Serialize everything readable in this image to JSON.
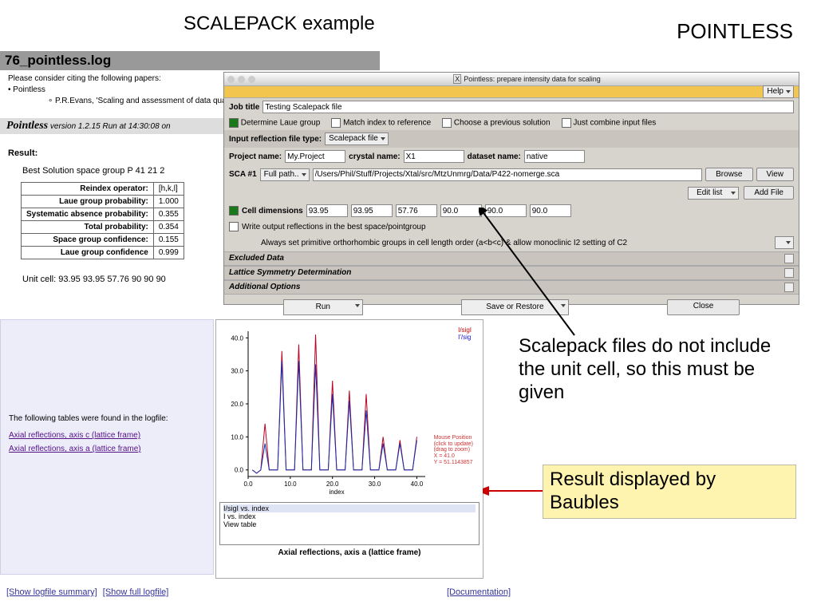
{
  "titles": {
    "left": "SCALEPACK example",
    "right": "POINTLESS"
  },
  "log": {
    "filename": "76_pointless.log",
    "intro": "Please consider citing the following papers:",
    "ref_item": "Pointless",
    "ref_detail": "P.R.Evans, 'Scaling and assessment of data quality', Acta",
    "section_hdr": "Pointless",
    "section_sub": "version 1.2.15 Run at 14:30:08 on",
    "result_label": "Result:",
    "best_solution": "Best Solution space group P 41 21 2",
    "table": {
      "rows": [
        {
          "k": "Reindex operator:",
          "v": "[h,k,l]"
        },
        {
          "k": "Laue group probability:",
          "v": "1.000"
        },
        {
          "k": "Systematic absence probability:",
          "v": "0.355"
        },
        {
          "k": "Total probability:",
          "v": "0.354"
        },
        {
          "k": "Space group confidence:",
          "v": "0.155"
        },
        {
          "k": "Laue group confidence",
          "v": "0.999"
        }
      ]
    },
    "unit_cell": "Unit cell: 93.95 93.95 57.76 90 90 90"
  },
  "dialog": {
    "window_title": "Pointless: prepare intensity data for scaling",
    "help": "Help",
    "job_title_label": "Job title",
    "job_title": "Testing Scalepack file",
    "opts": {
      "laue": "Determine Laue group",
      "match": "Match index to reference",
      "prev": "Choose a previous solution",
      "combine": "Just combine input files"
    },
    "filetype_label": "Input reflection file type:",
    "filetype_value": "Scalepack file",
    "project_label": "Project name:",
    "project": "My.Project",
    "crystal_label": "crystal name:",
    "crystal": "X1",
    "dataset_label": "dataset name:",
    "dataset": "native",
    "sca_label": "SCA #1",
    "fullpath_label": "Full path..",
    "sca_path": "/Users/Phil/Stuff/Projects/Xtal/src/MtzUnmrg/Data/P422-nomerge.sca",
    "browse": "Browse",
    "view": "View",
    "editlist": "Edit list",
    "addfile": "Add File",
    "celldim_label": "Cell dimensions",
    "cell": [
      "93.95",
      "93.95",
      "57.76",
      "90.0",
      "90.0",
      "90.0"
    ],
    "writeout": "Write output reflections in the best space/pointgroup",
    "primortho": "Always set primitive orthorhombic groups in cell length order (a<b<c) & allow monoclinic I2 setting of C2",
    "sections": [
      "Excluded Data",
      "Lattice Symmetry Determination",
      "Additional Options"
    ],
    "buttons": {
      "run": "Run",
      "save": "Save or Restore",
      "close": "Close"
    }
  },
  "baubles": {
    "intro": "The following tables were found in the logfile:",
    "links": [
      "Axial reflections, axis c (lattice frame)",
      "Axial reflections, axis a (lattice frame)"
    ]
  },
  "chart_panel": {
    "legend": [
      "I/sigI",
      "I'/sig"
    ],
    "mouse": [
      "Mouse Position",
      "(click to update)",
      "(drag to zoom)",
      "X = 41.0",
      "Y = 51.1143857"
    ],
    "listbox": [
      "I/sigI vs. index",
      "I vs. index",
      "View table"
    ],
    "caption": "Axial reflections, axis a (lattice frame)"
  },
  "chart_data": {
    "type": "line",
    "title": "Axial reflections, axis a (lattice frame)",
    "xlabel": "index",
    "ylabel": "I/sigI",
    "xlim": [
      0,
      42
    ],
    "ylim": [
      -2,
      42
    ],
    "x_ticks": [
      0.0,
      10.0,
      20.0,
      30.0,
      40.0
    ],
    "y_ticks": [
      0.0,
      10.0,
      20.0,
      30.0,
      40.0
    ],
    "series": [
      {
        "name": "I/sigI",
        "color": "#c00020",
        "x": [
          1,
          2,
          3,
          4,
          5,
          6,
          7,
          8,
          9,
          10,
          11,
          12,
          13,
          14,
          15,
          16,
          17,
          18,
          19,
          20,
          21,
          22,
          23,
          24,
          25,
          26,
          27,
          28,
          29,
          30,
          31,
          32,
          33,
          34,
          35,
          36,
          37,
          38,
          39,
          40
        ],
        "values": [
          0,
          -1,
          0,
          14,
          0,
          0,
          0,
          36,
          0,
          0,
          0,
          38,
          0,
          0,
          0,
          41,
          0,
          0,
          0,
          27,
          0,
          0,
          0,
          24,
          0,
          0,
          0,
          23,
          0,
          0,
          0,
          10,
          0,
          0,
          0,
          9,
          0,
          0,
          0,
          10
        ]
      },
      {
        "name": "I'/sig",
        "color": "#1030b0",
        "x": [
          1,
          2,
          3,
          4,
          5,
          6,
          7,
          8,
          9,
          10,
          11,
          12,
          13,
          14,
          15,
          16,
          17,
          18,
          19,
          20,
          21,
          22,
          23,
          24,
          25,
          26,
          27,
          28,
          29,
          30,
          31,
          32,
          33,
          34,
          35,
          36,
          37,
          38,
          39,
          40
        ],
        "values": [
          0,
          -1,
          0,
          8,
          0,
          0,
          0,
          33,
          0,
          0,
          0,
          33,
          0,
          0,
          0,
          32,
          0,
          0,
          0,
          23,
          0,
          0,
          0,
          21,
          0,
          0,
          0,
          18,
          0,
          0,
          0,
          8,
          0,
          0,
          0,
          8,
          0,
          0,
          0,
          9
        ]
      }
    ]
  },
  "annotations": {
    "a1": "Scalepack files do not include the unit cell, so this must be given",
    "a2": "Result displayed by Baubles"
  },
  "bottom": {
    "show_summary": "[Show logfile summary]",
    "show_full": "[Show full logfile]",
    "doc": "[Documentation]"
  }
}
